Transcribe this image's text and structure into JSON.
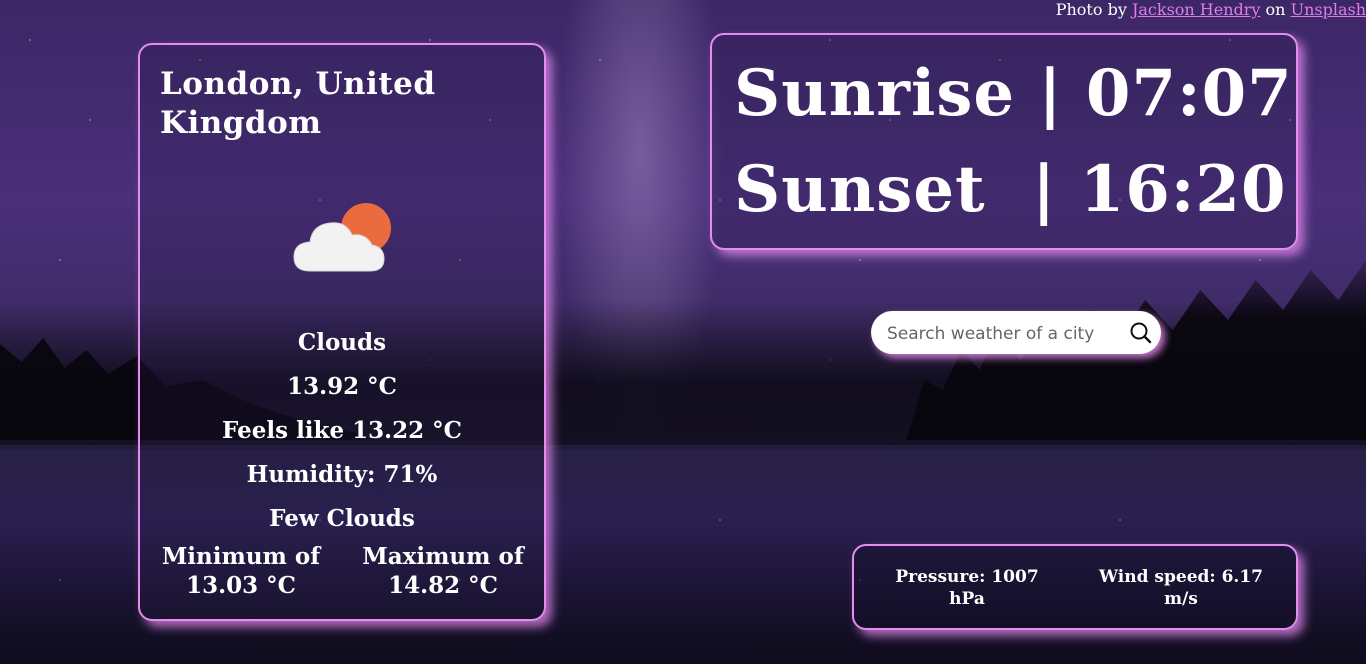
{
  "credit": {
    "prefix": "Photo by",
    "author": "Jackson Hendry",
    "middle": "on",
    "site": "Unsplash"
  },
  "location": "London, United Kingdom",
  "weather_icon": "cloud-sun-icon",
  "weather": {
    "main": "Clouds",
    "temperature": "13.92 °C",
    "feels_like": "Feels like 13.22 °C",
    "humidity": "Humidity: 71%",
    "description": "Few Clouds",
    "minimum": "Minimum of 13.03 °C",
    "maximum": "Maximum of 14.82 °C"
  },
  "sun": {
    "sunrise": "Sunrise | 07:07",
    "sunset": "Sunset  | 16:20"
  },
  "search": {
    "placeholder": "Search weather of a city",
    "icon": "search-icon"
  },
  "details": {
    "pressure": "Pressure: 1007 hPa",
    "wind": "Wind speed: 6.17 m/s"
  },
  "colors": {
    "accent": "#e48cf0",
    "link": "#e07ce8",
    "sun": "#ea6b3e",
    "cloud": "#f2f2f2"
  }
}
